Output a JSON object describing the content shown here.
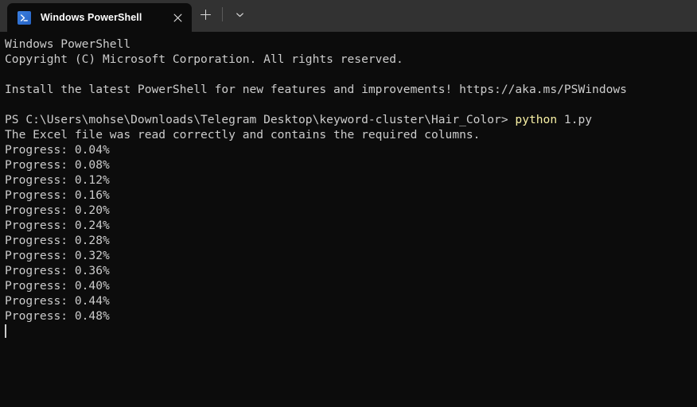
{
  "window": {
    "app_name": "Windows PowerShell"
  },
  "titlebar": {
    "tab": {
      "title": "Windows PowerShell",
      "icon_name": "powershell-icon",
      "close_label": "×"
    },
    "new_tab_label": "+",
    "dropdown_label": "⌄"
  },
  "terminal": {
    "colors": {
      "background": "#0c0c0c",
      "foreground": "#cccccc",
      "yellow": "#f9f1a5",
      "titlebar": "#323232",
      "icon_blue": "#2d6fd4"
    },
    "lines": [
      {
        "id": "banner-title",
        "segments": [
          {
            "text": "Windows PowerShell",
            "color": "white"
          }
        ]
      },
      {
        "id": "banner-copyright",
        "segments": [
          {
            "text": "Copyright (C) Microsoft Corporation. All rights reserved.",
            "color": "white"
          }
        ]
      },
      {
        "id": "blank-1",
        "segments": [
          {
            "text": "",
            "color": "white"
          }
        ]
      },
      {
        "id": "banner-install",
        "segments": [
          {
            "text": "Install the latest PowerShell for new features and improvements! https://aka.ms/PSWindows",
            "color": "white"
          }
        ]
      },
      {
        "id": "blank-2",
        "segments": [
          {
            "text": "",
            "color": "white"
          }
        ]
      },
      {
        "id": "prompt-command",
        "segments": [
          {
            "text": "PS C:\\Users\\mohse\\Downloads\\Telegram Desktop\\keyword-cluster\\Hair_Color> ",
            "color": "white"
          },
          {
            "text": "python",
            "color": "yellow"
          },
          {
            "text": " 1.py",
            "color": "white"
          }
        ]
      },
      {
        "id": "output-excel-ok",
        "segments": [
          {
            "text": "The Excel file was read correctly and contains the required columns.",
            "color": "white"
          }
        ]
      },
      {
        "id": "progress-1",
        "segments": [
          {
            "text": "Progress: 0.04%",
            "color": "white"
          }
        ]
      },
      {
        "id": "progress-2",
        "segments": [
          {
            "text": "Progress: 0.08%",
            "color": "white"
          }
        ]
      },
      {
        "id": "progress-3",
        "segments": [
          {
            "text": "Progress: 0.12%",
            "color": "white"
          }
        ]
      },
      {
        "id": "progress-4",
        "segments": [
          {
            "text": "Progress: 0.16%",
            "color": "white"
          }
        ]
      },
      {
        "id": "progress-5",
        "segments": [
          {
            "text": "Progress: 0.20%",
            "color": "white"
          }
        ]
      },
      {
        "id": "progress-6",
        "segments": [
          {
            "text": "Progress: 0.24%",
            "color": "white"
          }
        ]
      },
      {
        "id": "progress-7",
        "segments": [
          {
            "text": "Progress: 0.28%",
            "color": "white"
          }
        ]
      },
      {
        "id": "progress-8",
        "segments": [
          {
            "text": "Progress: 0.32%",
            "color": "white"
          }
        ]
      },
      {
        "id": "progress-9",
        "segments": [
          {
            "text": "Progress: 0.36%",
            "color": "white"
          }
        ]
      },
      {
        "id": "progress-10",
        "segments": [
          {
            "text": "Progress: 0.40%",
            "color": "white"
          }
        ]
      },
      {
        "id": "progress-11",
        "segments": [
          {
            "text": "Progress: 0.44%",
            "color": "white"
          }
        ]
      },
      {
        "id": "progress-12",
        "segments": [
          {
            "text": "Progress: 0.48%",
            "color": "white"
          }
        ]
      }
    ]
  }
}
